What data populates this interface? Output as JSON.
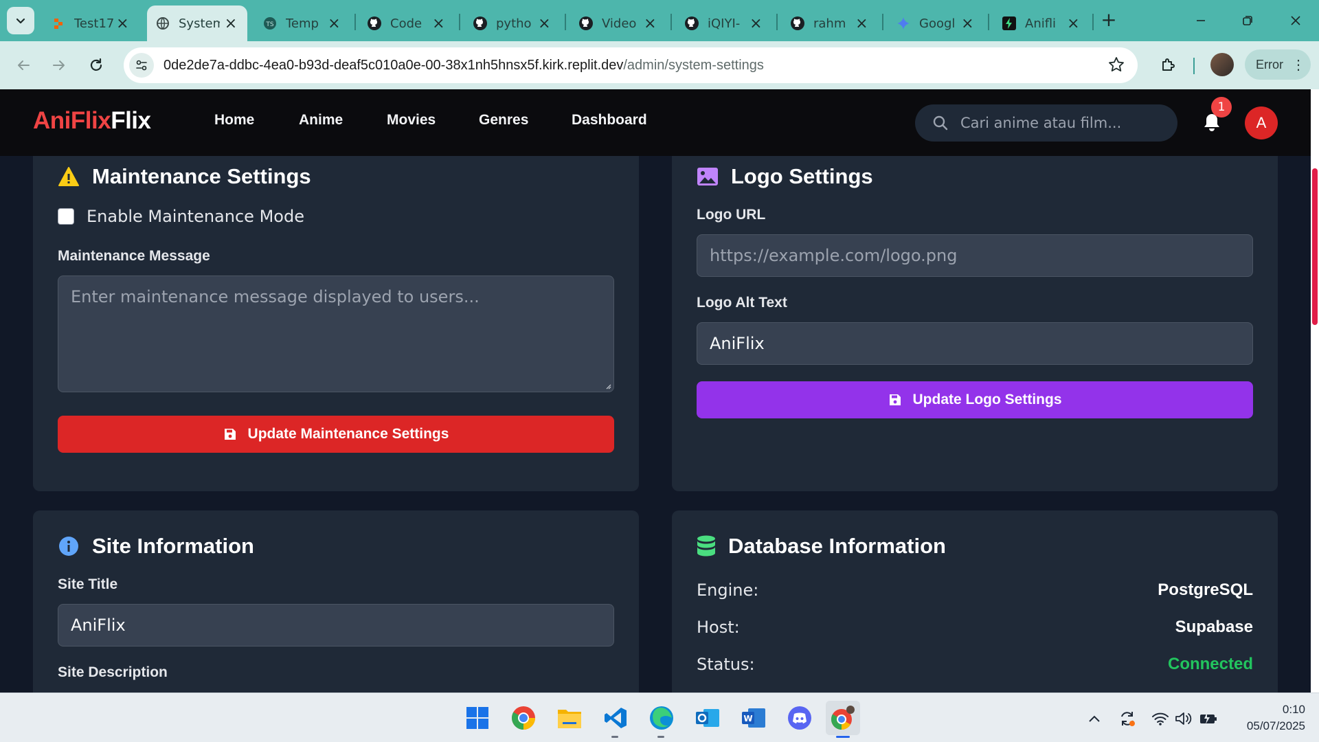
{
  "browser": {
    "tabs": [
      {
        "title": "Test17",
        "icon": "replit-icon",
        "active": false
      },
      {
        "title": "System",
        "icon": "globe-icon",
        "active": true
      },
      {
        "title": "Temp",
        "icon": "template-icon",
        "active": false
      },
      {
        "title": "Code",
        "icon": "github-icon",
        "active": false
      },
      {
        "title": "pytho",
        "icon": "github-icon",
        "active": false
      },
      {
        "title": "Video",
        "icon": "github-icon",
        "active": false
      },
      {
        "title": "iQIYI-",
        "icon": "github-icon",
        "active": false
      },
      {
        "title": "rahm",
        "icon": "github-icon",
        "active": false
      },
      {
        "title": "Googl",
        "icon": "gemini-icon",
        "active": false
      },
      {
        "title": "Anifli",
        "icon": "bolt-icon",
        "active": false
      }
    ],
    "url_host": "0de2de7a-ddbc-4ea0-b93d-deaf5c010a0e-00-38x1nh5hnsx5f.kirk.replit.dev",
    "url_path": "/admin/system-settings",
    "error_label": "Error"
  },
  "nav": {
    "brand_part1": "AniFlix",
    "brand_part2": "Flix",
    "links": [
      "Home",
      "Anime",
      "Movies",
      "Genres",
      "Dashboard"
    ],
    "search_placeholder": "Cari anime atau film...",
    "notification_count": "1",
    "avatar_initial": "A"
  },
  "maintenance": {
    "title": "Maintenance Settings",
    "enable_label": "Enable Maintenance Mode",
    "enabled": false,
    "message_label": "Maintenance Message",
    "message_placeholder": "Enter maintenance message displayed to users...",
    "button_label": "Update Maintenance Settings"
  },
  "logo": {
    "title": "Logo Settings",
    "url_label": "Logo URL",
    "url_placeholder": "https://example.com/logo.png",
    "alt_label": "Logo Alt Text",
    "alt_value": "AniFlix",
    "button_label": "Update Logo Settings"
  },
  "site_info": {
    "title": "Site Information",
    "site_title_label": "Site Title",
    "site_title_value": "AniFlix",
    "site_desc_label": "Site Description"
  },
  "database": {
    "title": "Database Information",
    "rows": [
      {
        "key": "Engine:",
        "value": "PostgreSQL"
      },
      {
        "key": "Host:",
        "value": "Supabase"
      },
      {
        "key": "Status:",
        "value": "Connected"
      }
    ]
  },
  "taskbar": {
    "apps": [
      "windows-start-icon",
      "chrome-icon",
      "file-explorer-icon",
      "vscode-icon",
      "edge-icon",
      "outlook-icon",
      "word-icon",
      "discord-icon",
      "chrome-profile-icon"
    ],
    "time": "0:10",
    "date": "05/07/2025"
  },
  "colors": {
    "accent_red": "#dc2626",
    "accent_purple": "#9333ea",
    "status_ok": "#22c55e",
    "card_bg": "#1f2937",
    "page_bg": "#111827"
  }
}
